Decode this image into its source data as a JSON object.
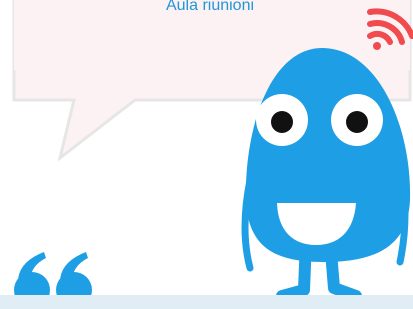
{
  "speech_bubble": {
    "caption": "Aula riunioni"
  },
  "icons": {
    "wifi": "wifi-icon",
    "quote": "quote-mark-icon",
    "mascot": "blue-mascot"
  },
  "colors": {
    "caption_text": "#2196d8",
    "bubble_fill": "#fdf2f3",
    "bubble_outline": "#e6e6e6",
    "mascot_blue": "#1e9fe5",
    "wifi_red": "#f04b4f",
    "quote_blue": "#1e9fe5",
    "band": "#e1edf5"
  }
}
